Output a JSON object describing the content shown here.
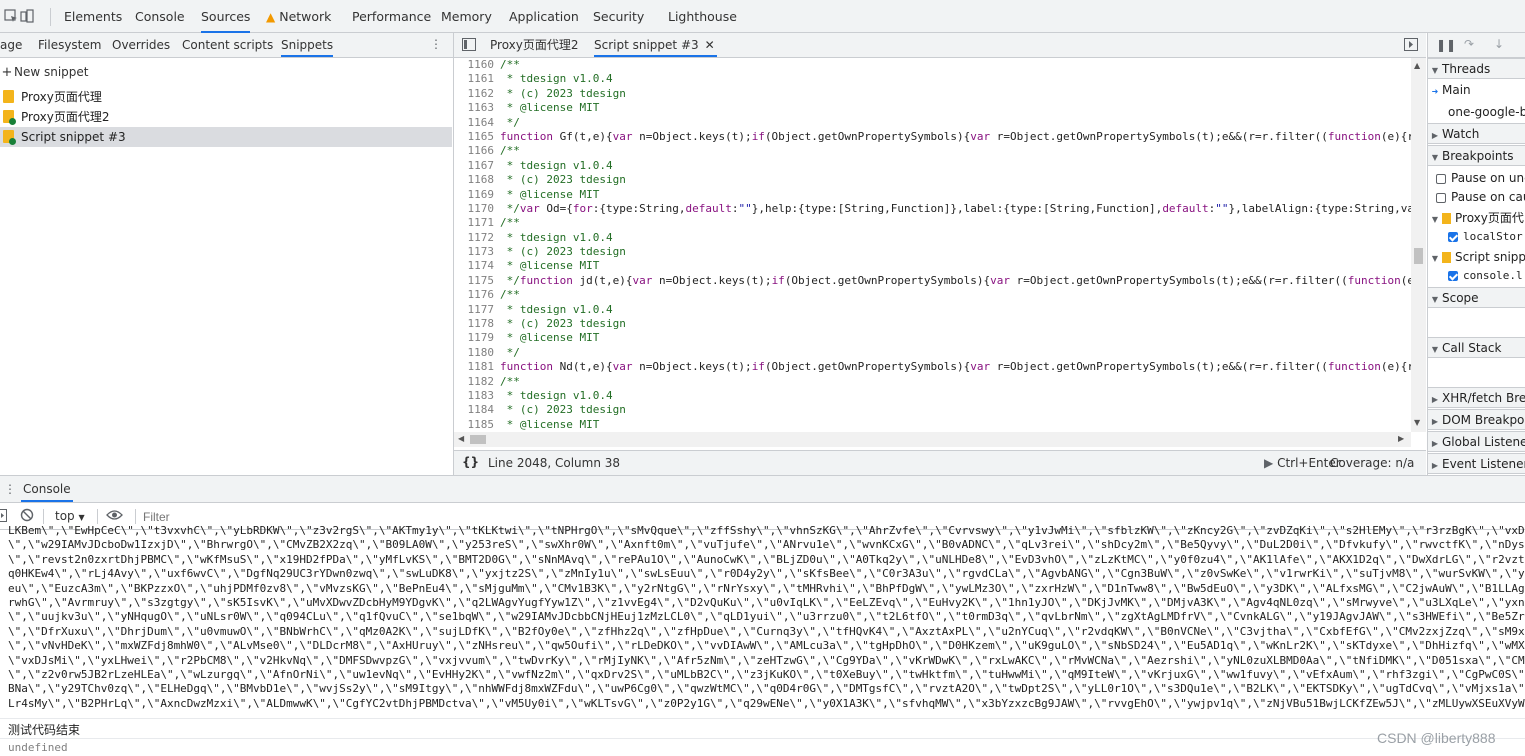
{
  "top_tabs": [
    "Elements",
    "Console",
    "Sources",
    "Network",
    "Performance",
    "Memory",
    "Application",
    "Security",
    "Lighthouse"
  ],
  "active_top_tab": "Sources",
  "navigator_tabs": [
    "age",
    "Filesystem",
    "Overrides",
    "Content scripts",
    "Snippets"
  ],
  "new_snippet_label": "New snippet",
  "snippets": [
    "Proxy页面代理",
    "Proxy页面代理2",
    "Script snippet #3"
  ],
  "editor_tabs": [
    "Proxy页面代理2",
    "Script snippet #3"
  ],
  "gutter_lines": [
    "1160",
    "1161",
    "1162",
    "1163",
    "1164",
    "1165",
    "1166",
    "1167",
    "1168",
    "1169",
    "1170",
    "1171",
    "1172",
    "1173",
    "1174",
    "1175",
    "1176",
    "1177",
    "1178",
    "1179",
    "1180",
    "1181",
    "1182",
    "1183",
    "1184",
    "1185",
    "1186"
  ],
  "code_lines": [
    "/**",
    " * tdesign v1.0.4",
    " * (c) 2023 tdesign",
    " * @license MIT",
    " */",
    "function Gf(t,e){var n=Object.keys(t);if(Object.getOwnPropertySymbols){var r=Object.getOwnPropertySymbols(t);e&&(r=r.filter((function(e){r",
    "/**",
    " * tdesign v1.0.4",
    " * (c) 2023 tdesign",
    " * @license MIT",
    " */var Od={for:{type:String,default:\"\"},help:{type:[String,Function]},label:{type:[String,Function],default:\"\"},labelAlign:{type:String,va",
    "/**",
    " * tdesign v1.0.4",
    " * (c) 2023 tdesign",
    " * @license MIT",
    " */function jd(t,e){var n=Object.keys(t);if(Object.getOwnPropertySymbols){var r=Object.getOwnPropertySymbols(t);e&&(r=r.filter((function(e",
    "/**",
    " * tdesign v1.0.4",
    " * (c) 2023 tdesign",
    " * @license MIT",
    " */",
    "function Nd(t,e){var n=Object.keys(t);if(Object.getOwnPropertySymbols){var r=Object.getOwnPropertySymbols(t);e&&(r=r.filter((function(e){r",
    "/**",
    " * tdesign v1.0.4",
    " * (c) 2023 tdesign",
    " * @license MIT",
    " */"
  ],
  "status": {
    "cursor": "Line 2048, Column 38",
    "run_hint": "Ctrl+Enter",
    "coverage": "Coverage: n/a"
  },
  "right_panel": {
    "threads_label": "Threads",
    "main_thread": "Main",
    "google_thread": "one-google-ba",
    "watch_label": "Watch",
    "breakpoints_label": "Breakpoints",
    "pause_uncaught": "Pause on unca",
    "pause_caught": "Pause on caug",
    "bp_file1": "Proxy页面代",
    "bp_code1": "localStor",
    "bp_file2": "Script snipp",
    "bp_code2": "console.l",
    "scope_label": "Scope",
    "callstack_label": "Call Stack",
    "xhr_label": "XHR/fetch Brea",
    "dom_label": "DOM Breakpoin",
    "global_label": "Global Listener",
    "event_label": "Event Listener B"
  },
  "drawer_tab": "Console",
  "console_toolbar": {
    "context": "top",
    "filter_placeholder": "Filter"
  },
  "console_lines": [
    "LKBem\\\",\\\"EwHpCeC\\\",\\\"t3vxvhC\\\",\\\"yLbRDKW\\\",\\\"z3v2rgS\\\",\\\"AKTmy1y\\\",\\\"tKLKtwi\\\",\\\"tNPHrgO\\\",\\\"sMvQque\\\",\\\"zffSshy\\\",\\\"vhnSzKG\\\",\\\"AhrZvfe\\\",\\\"Cvrvswy\\\",\\\"y1vJwMi\\\",\\\"sfblzKW\\\",\\\"zKncy2G\\\",\\\"zvDZqKi\\\",\\\"s2HlEMy\\\",\\\"r3rzBgK\\\",\\\"vxDt",
    "\\\",\\\"w29IAMvJDcboDw1IzxjD\\\",\\\"BhrwrgO\\\",\\\"CMvZB2X2zq\\\",\\\"B09LA0W\\\",\\\"y253reS\\\",\\\"swXhr0W\\\",\\\"Axnft0m\\\",\\\"vuTjufe\\\",\\\"ANrvu1e\\\",\\\"wvnKCxG\\\",\\\"B0vADNC\\\",\\\"qLv3rei\\\",\\\"shDcy2m\\\",\\\"Be5Qyvy\\\",\\\"DuL2D0i\\\",\\\"Dfvkufy\\\",\\\"rwvctfK\\\",\\\"nDys",
    "\\\",\\\"revst2n0zxrtDhjPBMC\\\",\\\"wKfMsuS\\\",\\\"x19HD2fPDa\\\",\\\"yMfLvKS\\\",\\\"BMT2D0G\\\",\\\"sNnMAvq\\\",\\\"rePAu1O\\\",\\\"AunoCwK\\\",\\\"BLjZD0u\\\",\\\"A0Tkq2y\\\",\\\"uNLHDe8\\\",\\\"EvD3vhO\\\",\\\"zLzKtMC\\\",\\\"y0f0zu4\\\",\\\"AK1lAfe\\\",\\\"AKX1D2q\\\",\\\"DwXdrLG\\\",\\\"r2vzt3q",
    "q0HKEw4\\\",\\\"rLj4Avy\\\",\\\"uxf6wvC\\\",\\\"DgfNq29UC3rYDwn0zwq\\\",\\\"swLuDK8\\\",\\\"yxjtz2S\\\",\\\"zMnIy1u\\\",\\\"swLsEuu\\\",\\\"r0D4y2y\\\",\\\"sKfsBee\\\",\\\"C0r3A3u\\\",\\\"rgvdCLa\\\",\\\"AgvbANG\\\",\\\"Cgn3BuW\\\",\\\"z0vSwKe\\\",\\\"v1rwrKi\\\",\\\"suTjvM8\\\",\\\"wurSvKW\\\",\\\"yu",
    "eu\\\",\\\"EuzcA3m\\\",\\\"BKPzzxO\\\",\\\"uhjPDMf0zv8\\\",\\\"vMvzsKG\\\",\\\"BePnEu4\\\",\\\"sMjguMm\\\",\\\"CMv1B3K\\\",\\\"y2rNtgG\\\",\\\"rNrYsxy\\\",\\\"tMHRvhi\\\",\\\"BhPfDgW\\\",\\\"ywLMz3O\\\",\\\"zxrHzW\\\",\\\"D1nTww8\\\",\\\"Bw5dEuO\\\",\\\"y3DK\\\",\\\"ALfxsMG\\\",\\\"C2jwAuW\\\",\\\"B1LLAg4",
    "rwhG\\\",\\\"Avrmruy\\\",\\\"s3zgtgy\\\",\\\"sK5IsvK\\\",\\\"uMvXDwvZDcbHyM9YDgvK\\\",\\\"q2LWAgvYugfYyw1Z\\\",\\\"z1vvEg4\\\",\\\"D2vQuKu\\\",\\\"u0vIqLK\\\",\\\"EeLZEvq\\\",\\\"EuHvy2K\\\",\\\"1hn1yJO\\\",\\\"DKjJvMK\\\",\\\"DMjvA3K\\\",\\\"Agv4qNL0zq\\\",\\\"sMrwyve\\\",\\\"u3LXqLe\\\",\\\"yxnU",
    "\\\",\\\"uujkv3u\\\",\\\"yNHqugO\\\",\\\"uNLsr0W\\\",\\\"q094CLu\\\",\\\"q1fQvuC\\\",\\\"se1bqW\\\",\\\"w29IAMvJDcbbCNjHEuj1zMzLCL0\\\",\\\"qLD1yui\\\",\\\"u3rrzu0\\\",\\\"t2L6tfO\\\",\\\"t0rmD3q\\\",\\\"qvLbrNm\\\",\\\"zgXtAgLMDfrV\\\",\\\"CvnkALG\\\",\\\"y19JAgvJAW\\\",\\\"s3HWEfi\\\",\\\"Be5Zr1u",
    "\\\",\\\"DfrXuxu\\\",\\\"DhrjDum\\\",\\\"u0vmuwO\\\",\\\"BNbWrhC\\\",\\\"qMz0A2K\\\",\\\"sujLDfK\\\",\\\"B2fOy0e\\\",\\\"zfHhz2q\\\",\\\"zfHpDue\\\",\\\"Curnq3y\\\",\\\"tfHQvK4\\\",\\\"AxztAxPL\\\",\\\"u2nYCuq\\\",\\\"r2vdqKW\\\",\\\"B0nVCNe\\\",\\\"C3vjtha\\\",\\\"CxbfEfG\\\",\\\"CMv2zxjZzq\\\",\\\"sM9xD",
    "\\\",\\\"vNvHDeK\\\",\\\"mxWZFdj8mhW0\\\",\\\"ALvMse0\\\",\\\"DLDcrM8\\\",\\\"AxHUruy\\\",\\\"zNHsreu\\\",\\\"qw5Oufi\\\",\\\"rLDeDKO\\\",\\\"vvDIAwW\\\",\\\"AMLcu3a\\\",\\\"tgHpDhO\\\",\\\"D0HKzem\\\",\\\"uK9guLO\\\",\\\"sNbSD24\\\",\\\"Eu5AD1q\\\",\\\"wKnLr2K\\\",\\\"sKTdyxe\\\",\\\"DhHizfq\\\",\\\"wMXhA",
    "\\\"vxDJsMi\\\",\\\"yxLHwei\\\",\\\"r2PbCM8\\\",\\\"v2HkvNq\\\",\\\"DMFSDwvpzG\\\",\\\"vxjvvum\\\",\\\"twDvrKy\\\",\\\"rMjIyNK\\\",\\\"Afr5zNm\\\",\\\"zeHTzwG\\\",\\\"Cg9YDa\\\",\\\"vKrWDwK\\\",\\\"rxLwAKC\\\",\\\"rMvWCNa\\\",\\\"Aezrshi\\\",\\\"yNL0zuXLBMD0Aa\\\",\\\"tNfiDMK\\\",\\\"D051sxa\\\",\\\"CMPv",
    "\\\",\\\"z2v0rw5JB2rLzeHLEa\\\",\\\"wLzurgq\\\",\\\"AfnOrNi\\\",\\\"uw1evNq\\\",\\\"EvHHy2K\\\",\\\"vwfNz2m\\\",\\\"qxDrv2S\\\",\\\"uMLbB2C\\\",\\\"z3jKuKO\\\",\\\"t0XeBuy\\\",\\\"twHktfm\\\",\\\"tuHwwMi\\\",\\\"qM9IteW\\\",\\\"vKrjuxG\\\",\\\"ww1fuvy\\\",\\\"vEfxAum\\\",\\\"rhf3zgi\\\",\\\"CgPwC0S\\\",",
    "BNa\\\",\\\"y29TChv0zq\\\",\\\"ELHeDgq\\\",\\\"BMvbD1e\\\",\\\"wvjSs2y\\\",\\\"sM9Itgy\\\",\\\"nhWWFdj8mxWZFdu\\\",\\\"uwP6Cg0\\\",\\\"qwzWtMC\\\",\\\"q0D4r0G\\\",\\\"DMTgsfC\\\",\\\"rvztA2O\\\",\\\"twDpt2S\\\",\\\"yLL0r1O\\\",\\\"s3DQu1e\\\",\\\"B2LK\\\",\\\"EKTSDKy\\\",\\\"ugTdCvq\\\",\\\"vMjxs1a\\\",",
    "Lr4sMy\\\",\\\"B2PHrLq\\\",\\\"AxncDwzMzxi\\\",\\\"ALDmwwK\\\",\\\"CgfYC2vtDhjPBMDctva\\\",\\\"vM5Uy0i\\\",\\\"wKLTsvG\\\",\\\"z0P2y1G\\\",\\\"q29wENe\\\",\\\"y0X1A3K\\\",\\\"sfvhqMW\\\",\\\"x3bYzxzcBg9JAW\\\",\\\"rvvgEhO\\\",\\\"ywjpv1q\\\",\\\"zNjVBu51BwjLCKfZEw5J\\\",\\\"zMLUywXSEuXVyW\\\""
  ],
  "console_log_line": "测试代码结束",
  "console_undefined": "undefined",
  "watermark": "CSDN @liberty888"
}
